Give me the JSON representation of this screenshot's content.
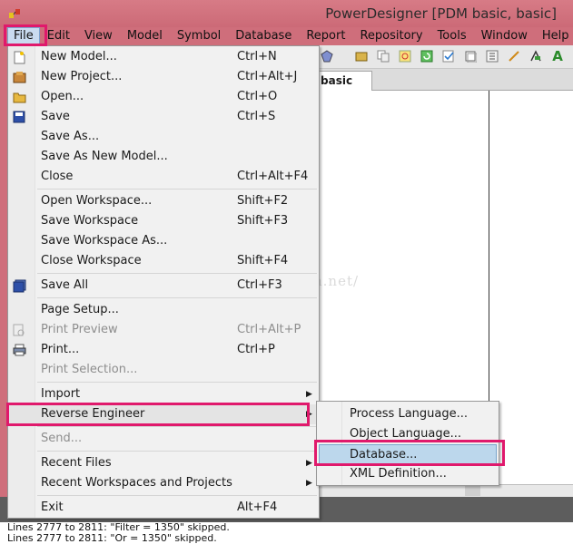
{
  "window": {
    "title": "PowerDesigner [PDM basic, basic]",
    "app_icon": "powerdesigner-icon"
  },
  "menubar": [
    {
      "label": "File",
      "active": true
    },
    {
      "label": "Edit"
    },
    {
      "label": "View"
    },
    {
      "label": "Model"
    },
    {
      "label": "Symbol"
    },
    {
      "label": "Database"
    },
    {
      "label": "Report"
    },
    {
      "label": "Repository"
    },
    {
      "label": "Tools"
    },
    {
      "label": "Window"
    },
    {
      "label": "Help"
    }
  ],
  "toolbar_icons": [
    "model-icon",
    "folder-icon",
    "copy-icon",
    "find-icon",
    "refresh-icon",
    "check-icon",
    "window-icon",
    "layout-icon",
    "brush-icon",
    "link-icon",
    "text-icon"
  ],
  "tab": {
    "label": "basic"
  },
  "file_menu": [
    {
      "label": "New Model...",
      "shortcut": "Ctrl+N",
      "icon": "new-model-icon"
    },
    {
      "label": "New Project...",
      "shortcut": "Ctrl+Alt+J",
      "icon": "new-project-icon"
    },
    {
      "label": "Open...",
      "shortcut": "Ctrl+O",
      "icon": "open-folder-icon"
    },
    {
      "label": "Save",
      "shortcut": "Ctrl+S",
      "icon": "save-icon"
    },
    {
      "label": "Save As...",
      "shortcut": ""
    },
    {
      "label": "Save As New Model...",
      "shortcut": ""
    },
    {
      "label": "Close",
      "shortcut": "Ctrl+Alt+F4"
    },
    {
      "label": "Open Workspace...",
      "shortcut": "Shift+F2"
    },
    {
      "label": "Save Workspace",
      "shortcut": "Shift+F3"
    },
    {
      "label": "Save Workspace As...",
      "shortcut": ""
    },
    {
      "label": "Close Workspace",
      "shortcut": "Shift+F4"
    },
    {
      "label": "Save All",
      "shortcut": "Ctrl+F3",
      "icon": "save-all-icon"
    },
    {
      "label": "Page Setup...",
      "shortcut": ""
    },
    {
      "label": "Print Preview",
      "shortcut": "Ctrl+Alt+P",
      "icon": "print-preview-icon",
      "disabled": true
    },
    {
      "label": "Print...",
      "shortcut": "Ctrl+P",
      "icon": "printer-icon"
    },
    {
      "label": "Print Selection...",
      "shortcut": "",
      "disabled": true
    },
    {
      "label": "Import",
      "submenu": true
    },
    {
      "label": "Reverse Engineer",
      "submenu": true,
      "highlighted": true
    },
    {
      "label": "Send...",
      "disabled": true
    },
    {
      "label": "Recent Files",
      "submenu": true
    },
    {
      "label": "Recent Workspaces and Projects",
      "submenu": true
    },
    {
      "label": "Exit",
      "shortcut": "Alt+F4"
    }
  ],
  "reverse_engineer_submenu": [
    {
      "label": "Process Language..."
    },
    {
      "label": "Object Language..."
    },
    {
      "label": "Database...",
      "selected": true
    },
    {
      "label": "XML Definition..."
    }
  ],
  "output": [
    "Lines 2777 to 2811:  \"Filter = 1350\" skipped.",
    "Lines 2777 to 2811:  \"Or = 1350\" skipped."
  ],
  "watermark": "http://blog.csdn.net/",
  "colors": {
    "highlight_border": "#e0196c",
    "titlebar": "#cf6e7b",
    "selected_item": "#bcd7ec"
  }
}
